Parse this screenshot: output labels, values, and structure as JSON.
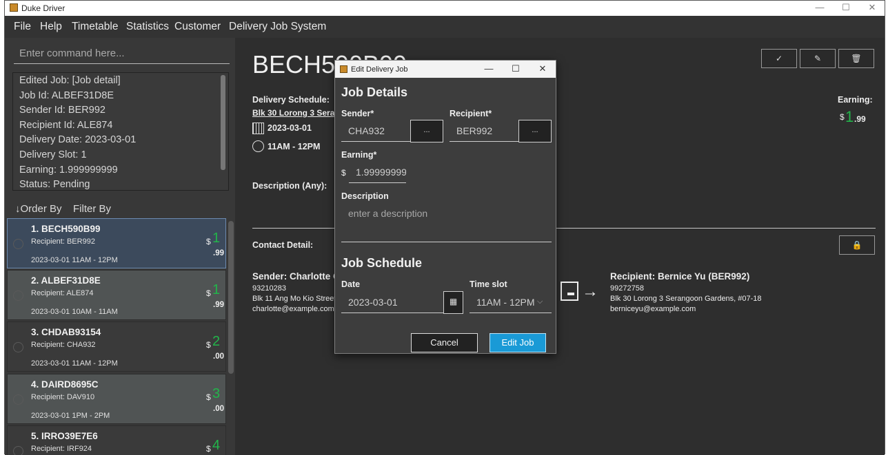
{
  "window": {
    "title": "Duke Driver",
    "minimize": "—",
    "maximize": "☐",
    "close": "✕"
  },
  "menu": [
    "File",
    "Help",
    "Timetable",
    "Statistics",
    "Customer",
    "Delivery Job System"
  ],
  "command": {
    "placeholder": "Enter command here..."
  },
  "result_lines": [
    "Edited Job: [Job detail]",
    "Job Id: ALBEF31D8E",
    "Sender Id: BER992",
    "Recipient Id: ALE874",
    "Delivery Date: 2023-03-01",
    "Delivery Slot: 1",
    "Earning: 1.999999999",
    "Status: Pending"
  ],
  "list_controls": {
    "order_by": "↓Order By",
    "filter_by": "Filter By"
  },
  "jobs": [
    {
      "title": "1.  BECH590B99",
      "recipient": "Recipient: BER992",
      "datetime": "2023-03-01 11AM - 12PM",
      "currency": "$",
      "amount": "1",
      "cents": ".99",
      "color": "#3c4a5c"
    },
    {
      "title": "2.  ALBEF31D8E",
      "recipient": "Recipient: ALE874",
      "datetime": "2023-03-01 10AM - 11AM",
      "currency": "$",
      "amount": "1",
      "cents": ".99",
      "color": "#505454"
    },
    {
      "title": "3.  CHDAB93154",
      "recipient": "Recipient: CHA932",
      "datetime": "2023-03-01 11AM - 12PM",
      "currency": "$",
      "amount": "2",
      "cents": ".00",
      "color": "#3a3a3a"
    },
    {
      "title": "4.  DAIRD8695C",
      "recipient": "Recipient: DAV910",
      "datetime": "2023-03-01 1PM  - 2PM",
      "currency": "$",
      "amount": "3",
      "cents": ".00",
      "color": "#505454"
    },
    {
      "title": "5.  IRRO39E7E6",
      "recipient": "Recipient: IRF924",
      "datetime": "",
      "currency": "$",
      "amount": "4",
      "cents": "",
      "color": "#3a3a3a"
    }
  ],
  "detail": {
    "job_id": "BECH590B99",
    "schedule_label": "Delivery Schedule:",
    "address": "Blk 30 Lorong 3 Serangoon Gardens, #07-18",
    "date": "2023-03-01",
    "slot": "11AM - 12PM",
    "description_label": "Description (Any):",
    "earning_label": "Earning:",
    "earning_currency": "$",
    "earning_amount": "1",
    "earning_cents": ".99",
    "contact_label": "Contact Detail:",
    "sender": {
      "heading": "Sender:  Charlotte Oliveiro  (CHA932)",
      "phone": "93210283",
      "address": "Blk 11 Ang Mo Kio Street 74, #11-04",
      "email": "charlotte@example.com"
    },
    "recipient": {
      "heading": "Recipient:  Bernice Yu   (BER992)",
      "phone": "99272758",
      "address": "Blk 30 Lorong 3 Serangoon Gardens, #07-18",
      "email": "berniceyu@example.com"
    },
    "buttons": {
      "complete": "✓",
      "edit": "✎",
      "delete": "🗑",
      "lock": "🔒"
    },
    "arrow": "→"
  },
  "dialog": {
    "title": "Edit Delivery Job",
    "minimize": "—",
    "maximize": "☐",
    "close": "✕",
    "job_details": "Job Details",
    "sender_label": "Sender*",
    "sender_value": "CHA932",
    "recipient_label": "Recipient*",
    "recipient_value": "BER992",
    "picker": "...",
    "earning_label": "Earning*",
    "earning_currency": "$",
    "earning_value": "1.999999999",
    "description_label": "Description",
    "description_placeholder": "enter a description",
    "job_schedule": "Job Schedule",
    "date_label": "Date",
    "date_value": "2023-03-01",
    "timeslot_label": "Time slot",
    "timeslot_value": "11AM - 12PM",
    "cancel": "Cancel",
    "submit": "Edit Job",
    "accent": "#1a9ad6"
  }
}
